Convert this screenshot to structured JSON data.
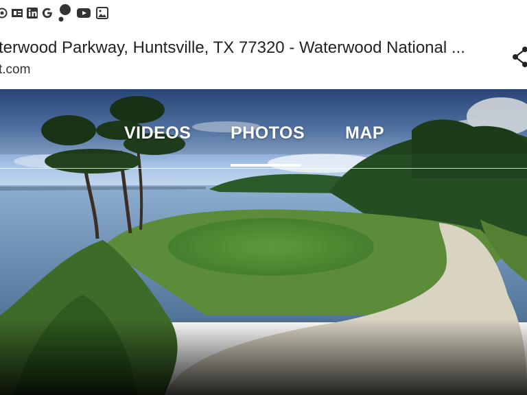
{
  "result": {
    "title": "terwood Parkway, Huntsville, TX 77320 - Waterwood National ...",
    "url": "t.com"
  },
  "icons": [
    "circle-icon",
    "office-icon",
    "linkedin-icon",
    "google-icon",
    "assistant-icon",
    "youtube-icon",
    "image-icon"
  ],
  "tabs": [
    {
      "label": "VIDEOS",
      "active": false
    },
    {
      "label": "PHOTOS",
      "active": true
    },
    {
      "label": "MAP",
      "active": false
    }
  ]
}
